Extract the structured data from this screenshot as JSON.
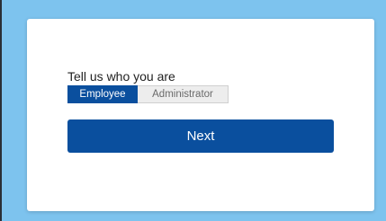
{
  "form": {
    "prompt": "Tell us who you are",
    "roles": [
      {
        "label": "Employee",
        "selected": true
      },
      {
        "label": "Administrator",
        "selected": false
      }
    ],
    "next_label": "Next"
  },
  "colors": {
    "page_background": "#7dc3ee",
    "card_background": "#ffffff",
    "accent": "#0a4f9e",
    "inactive_toggle": "#ededed"
  }
}
